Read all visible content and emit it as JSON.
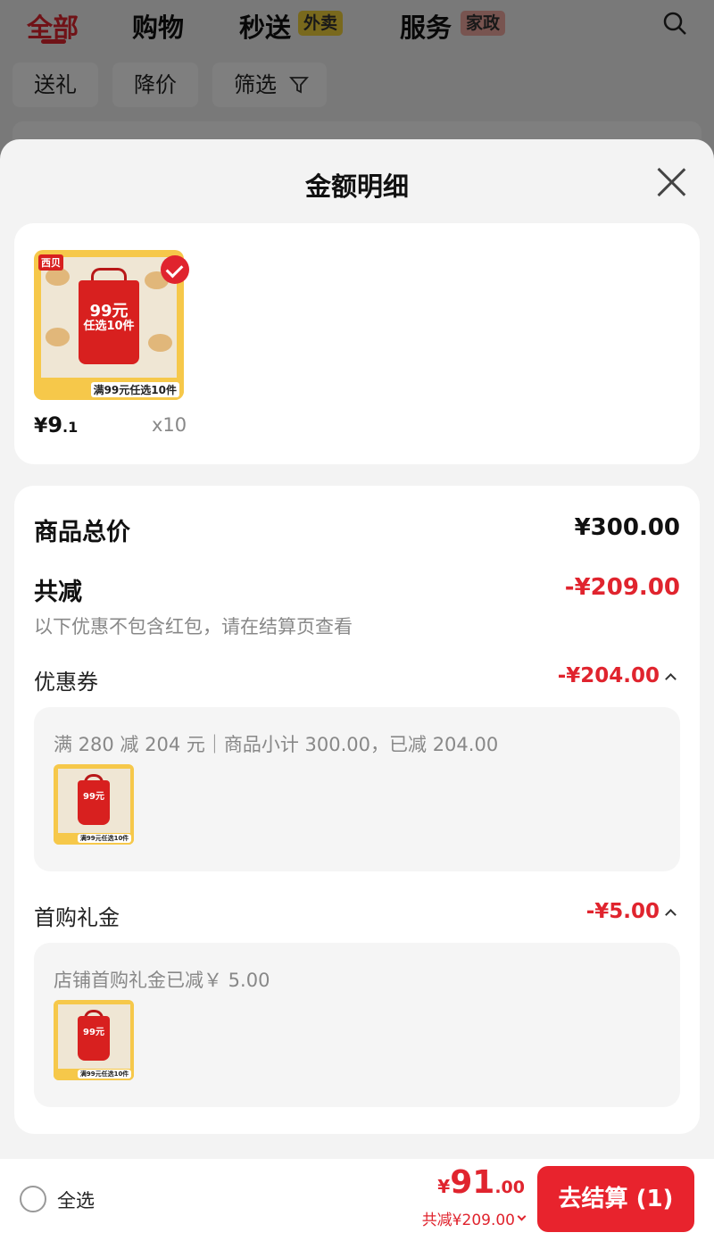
{
  "background": {
    "tabs": [
      "全部",
      "购物",
      "秒送",
      "服务"
    ],
    "badges": {
      "waimai": "外卖",
      "jiazheng": "家政"
    },
    "chips": [
      "送礼",
      "降价",
      "筛选"
    ]
  },
  "sheet": {
    "title": "金额明细",
    "product": {
      "price_symbol": "¥",
      "price_int": "9",
      "price_dec": ".1",
      "quantity": "x10",
      "image_text": {
        "logo": "西贝",
        "bag_line1": "99元",
        "bag_line2": "任选10件",
        "footer": "满99元任选10件"
      }
    },
    "detail": {
      "total_label": "商品总价",
      "total_value": "¥300.00",
      "discount_label": "共减",
      "discount_value": "-¥209.00",
      "note": "以下优惠不包含红包，请在结算页查看",
      "coupon": {
        "label": "优惠券",
        "value": "-¥204.00",
        "panel_text": "满 280 减 204 元｜商品小计 300.00，已减 204.00"
      },
      "first_purchase": {
        "label": "首购礼金",
        "value": "-¥5.00",
        "panel_text": "店铺首购礼金已减￥ 5.00"
      }
    }
  },
  "bottom": {
    "select_all": "全选",
    "total_symbol": "¥",
    "total_int": "91",
    "total_dec": ".00",
    "total_sub": "共减¥209.00",
    "checkout": "去结算 (1)"
  },
  "colors": {
    "accent": "#e0242e",
    "checkout": "#e8232d",
    "text_secondary": "#888888"
  }
}
